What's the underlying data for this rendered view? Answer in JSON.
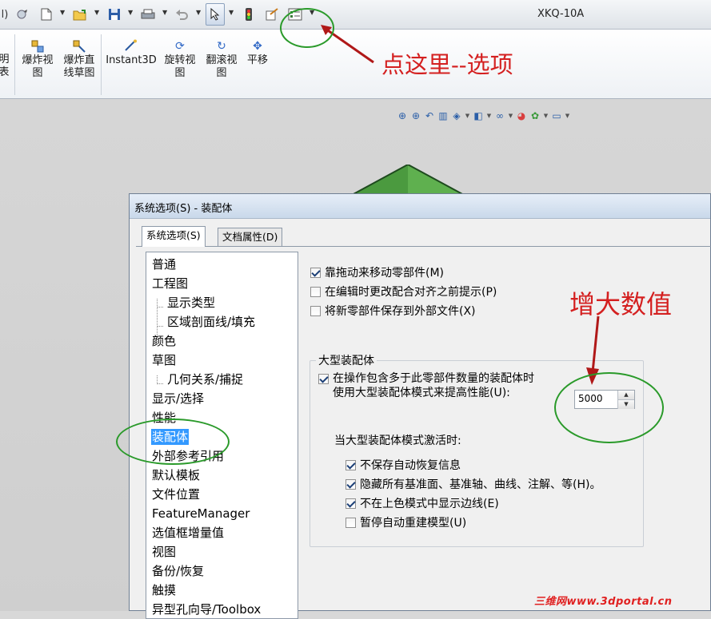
{
  "app": {
    "title": "XKQ-10A",
    "left_fragment": "l)",
    "colors": {
      "annotation": "#d42020",
      "ring": "#2a9a2a",
      "selection": "#3399ff",
      "icon": "#3169c6"
    },
    "quick_access": [
      {
        "icon": "new-document-icon"
      },
      {
        "icon": "open-folder-icon"
      },
      {
        "icon": "save-icon"
      },
      {
        "icon": "print-icon"
      },
      {
        "icon": "undo-icon"
      },
      {
        "icon": "select-cursor-icon"
      },
      {
        "icon": "traffic-light-icon"
      },
      {
        "icon": "file-properties-icon"
      },
      {
        "icon": "options-icon"
      }
    ]
  },
  "ribbon": {
    "partial": [
      "明",
      "表"
    ],
    "buttons": [
      {
        "label": [
          "爆炸视",
          "图"
        ],
        "icon": "explode-view-icon"
      },
      {
        "label": [
          "爆炸直",
          "线草图"
        ],
        "icon": "explode-line-sketch-icon"
      },
      {
        "label": [
          "Instant3D"
        ],
        "icon": "instant3d-icon"
      },
      {
        "label": [
          "旋转视",
          "图"
        ],
        "icon": "rotate-view-icon"
      },
      {
        "label": [
          "翻滚视",
          "图"
        ],
        "icon": "roll-view-icon"
      },
      {
        "label": [
          "平移"
        ],
        "icon": "pan-icon"
      }
    ]
  },
  "annotations": {
    "options_hint": "点这里--选项",
    "increase_hint": "增大数值",
    "watermark": "三维网www.3dportal.cn"
  },
  "dialog": {
    "title": "系统选项(S) - 装配体",
    "tabs": [
      {
        "label": "系统选项(S)",
        "active": true
      },
      {
        "label": "文档属性(D)",
        "active": false
      }
    ],
    "tree": [
      {
        "label": "普通"
      },
      {
        "label": "工程图"
      },
      {
        "label": "显示类型",
        "sub": true
      },
      {
        "label": "区域剖面线/填充",
        "sub": true
      },
      {
        "label": "颜色"
      },
      {
        "label": "草图"
      },
      {
        "label": "几何关系/捕捉",
        "sub": true
      },
      {
        "label": "显示/选择"
      },
      {
        "label": "性能"
      },
      {
        "label": "装配体",
        "selected": true
      },
      {
        "label": "外部参考引用"
      },
      {
        "label": "默认模板"
      },
      {
        "label": "文件位置"
      },
      {
        "label": "FeatureManager"
      },
      {
        "label": "选值框增量值"
      },
      {
        "label": "视图"
      },
      {
        "label": "备份/恢复"
      },
      {
        "label": "触摸"
      },
      {
        "label": "异型孔向导/Toolbox"
      }
    ],
    "options": [
      {
        "label": "靠拖动来移动零部件(M)",
        "checked": true
      },
      {
        "label": "在编辑时更改配合对齐之前提示(P)",
        "checked": false
      },
      {
        "label": "将新零部件保存到外部文件(X)",
        "checked": false
      }
    ],
    "large_assembly": {
      "title": "大型装配体",
      "use_mode_line1": "在操作包含多于此零部件数量的装配体时",
      "use_mode_line2": "使用大型装配体模式来提高性能(U):",
      "use_mode_checked": true,
      "threshold": "5000",
      "when_active": "当大型装配体模式激活时:",
      "sub_options": [
        {
          "label": "不保存自动恢复信息",
          "checked": true
        },
        {
          "label": "隐藏所有基准面、基准轴、曲线、注解、等(H)。",
          "checked": true
        },
        {
          "label": "不在上色模式中显示边线(E)",
          "checked": true
        },
        {
          "label": "暂停自动重建模型(U)",
          "checked": false
        }
      ]
    }
  }
}
